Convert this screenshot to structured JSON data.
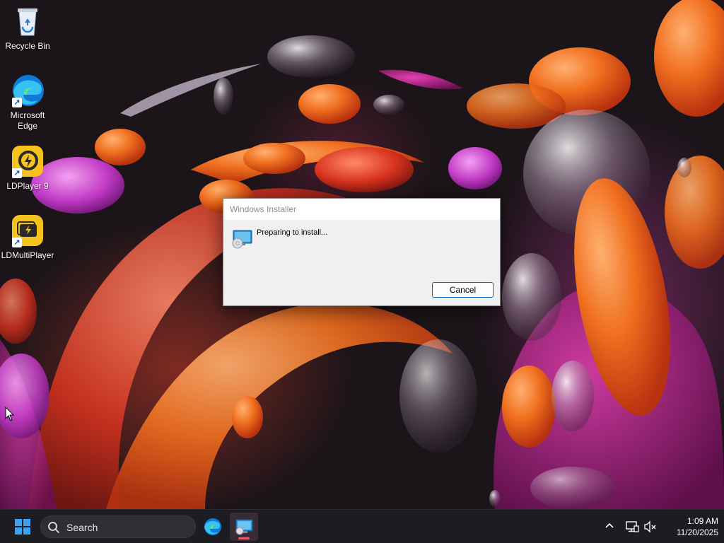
{
  "desktop": {
    "icons": [
      {
        "label": "Recycle Bin",
        "icon": "recycle-bin-icon"
      },
      {
        "label": "Microsoft Edge",
        "icon": "edge-icon"
      },
      {
        "label": "LDPlayer 9",
        "icon": "ldplayer-icon"
      },
      {
        "label": "LDMultiPlayer",
        "icon": "ldmultiplayer-icon"
      }
    ]
  },
  "dialog": {
    "title": "Windows Installer",
    "message": "Preparing to install...",
    "cancel_label": "Cancel",
    "icon": "installer-icon"
  },
  "taskbar": {
    "search_label": "Search",
    "apps": [
      {
        "icon": "edge-icon",
        "active": false
      },
      {
        "icon": "windows-installer-icon",
        "active": true
      }
    ],
    "tray": {
      "icons": [
        "chevron-up-icon",
        "network-icon",
        "volume-muted-icon"
      ]
    },
    "clock": {
      "time": "1:09 AM",
      "date": "11/20/2025"
    }
  },
  "colors": {
    "accent": "#0067c0",
    "taskbar": "#1c1c22",
    "running_indicator": "#f05a6e"
  }
}
